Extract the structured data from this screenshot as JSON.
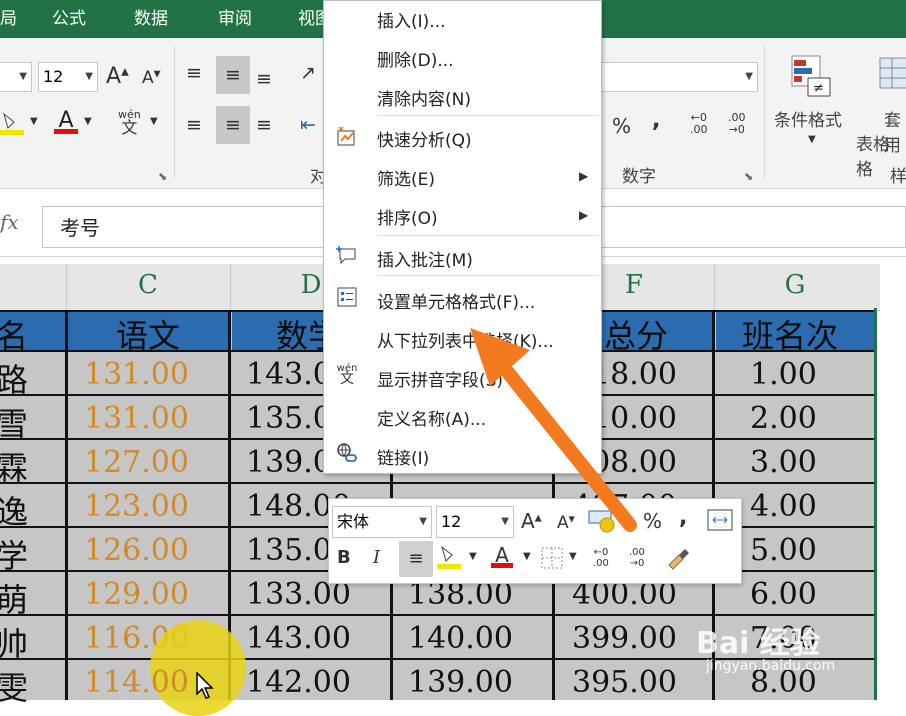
{
  "ribbon_tabs": [
    "局",
    "公式",
    "数据",
    "审阅",
    "视图"
  ],
  "ribbon": {
    "font_size": "12",
    "increase_font": "A",
    "decrease_font": "A",
    "font_color_icon": "A",
    "pinyin_label_top": "wén",
    "pinyin_label_bottom": "文",
    "percent": "%",
    "comma": ",",
    "dec_increase": "←0\n.00",
    "dec_decrease": ".00\n→0",
    "conditional_format": "条件格式",
    "table_format_top": "套用",
    "table_format_bottom": "表格格",
    "group_number": "数字",
    "group_align": "对",
    "group_styles": "样"
  },
  "formula_bar": {
    "fx": "fx",
    "value": "考号"
  },
  "columns": [
    "C",
    "D",
    "E",
    "F",
    "G"
  ],
  "header_row": {
    "name": "名",
    "chinese": "语文",
    "math": "数学",
    "total": "总分",
    "rank": "班名次"
  },
  "rows": [
    {
      "name": "路",
      "chinese": "131.00",
      "math": "143.00",
      "total": "418.00",
      "rank": "1.00"
    },
    {
      "name": "雪",
      "chinese": "131.00",
      "math": "135.00",
      "total": "410.00",
      "rank": "2.00"
    },
    {
      "name": "霖",
      "chinese": "127.00",
      "math": "139.00",
      "total": "408.00",
      "rank": "3.00"
    },
    {
      "name": "逸",
      "chinese": "123.00",
      "math": "148.00",
      "total": "407.00",
      "rank": "4.00"
    },
    {
      "name": "学",
      "chinese": "126.00",
      "math": "135.00",
      "total": "405.00",
      "rank": "5.00"
    },
    {
      "name": "萌",
      "chinese": "129.00",
      "math": "133.00",
      "total": "400.00",
      "rank": "6.00",
      "e": "138.00"
    },
    {
      "name": "帅",
      "chinese": "116.00",
      "math": "143.00",
      "total": "399.00",
      "rank": "7.00",
      "e": "140.00"
    },
    {
      "name": "雯",
      "chinese": "114.00",
      "math": "142.00",
      "total": "395.00",
      "rank": "8.00",
      "e": "139.00"
    }
  ],
  "context_menu": {
    "insert": "插入(I)...",
    "delete": "删除(D)...",
    "clear": "清除内容(N)",
    "quick_analysis": "快速分析(Q)",
    "filter": "筛选(E)",
    "sort": "排序(O)",
    "insert_comment": "插入批注(M)",
    "format_cells": "设置单元格格式(F)...",
    "pick_from_list": "从下拉列表中选择(K)...",
    "show_pinyin": "显示拼音字段(S)",
    "define_name": "定义名称(A)...",
    "link": "链接(I)"
  },
  "mini_toolbar": {
    "font": "宋体",
    "size": "12",
    "bold": "B",
    "italic": "I",
    "percent": "%",
    "comma": ","
  },
  "watermark": {
    "brand": "Bai 经验",
    "url": "jingyan.baidu.com"
  },
  "colors": {
    "ribbon_green": "#217346",
    "header_blue": "#2b6cb0",
    "accent_orange": "#f47a20",
    "chinese_orange": "#d08a2a"
  }
}
